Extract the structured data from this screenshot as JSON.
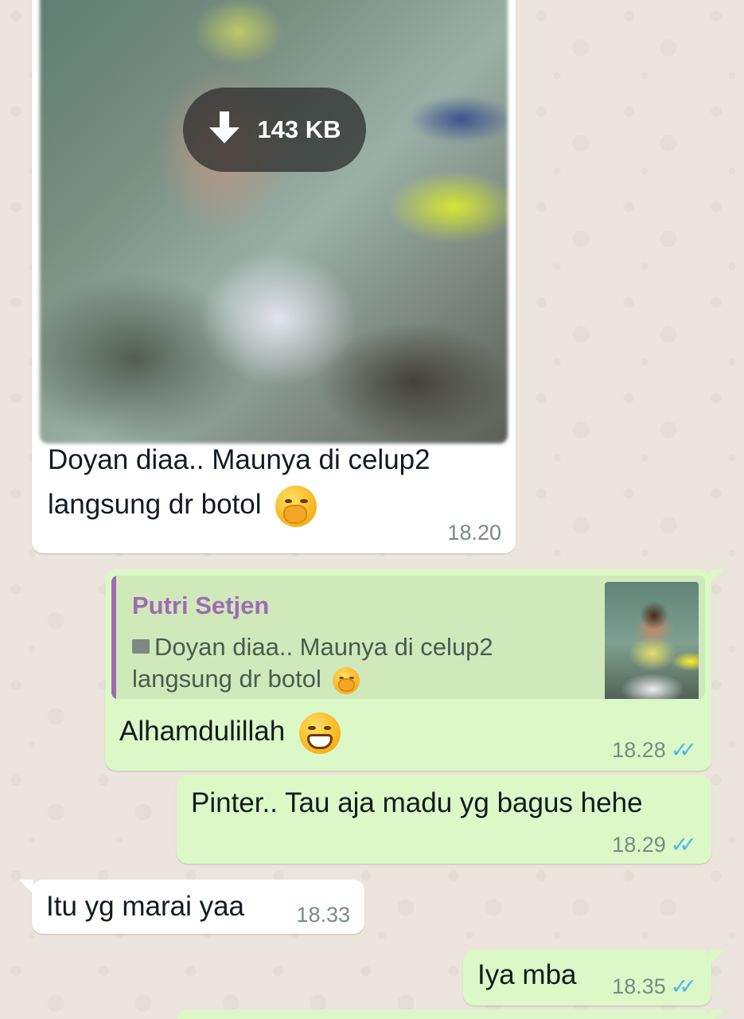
{
  "colors": {
    "wallpaper": "#ece5dd",
    "incoming_bubble": "#ffffff",
    "outgoing_bubble": "#dcf8c6",
    "quote_sender": "#9f6bb4",
    "read_ticks": "#4fb6ec"
  },
  "messages": [
    {
      "direction": "incoming",
      "type": "image",
      "download_size": "143 KB",
      "download_icon": "download-arrow-icon",
      "caption_line1": "Doyan diaa.. Maunya di celup2",
      "caption_line2": "langsung dr botol",
      "emoji": "face-with-hand-over-mouth",
      "time": "18.20"
    },
    {
      "direction": "outgoing",
      "type": "reply",
      "quoted": {
        "sender": "Putri Setjen",
        "icon": "image-icon",
        "text_line1": "Doyan diaa.. Maunya di celup2",
        "text_line2": "langsung dr botol",
        "emoji": "face-with-hand-over-mouth"
      },
      "text": "Alhamdulillah",
      "emoji": "grinning-face",
      "time": "18.28",
      "status": "read"
    },
    {
      "direction": "outgoing",
      "type": "text",
      "text": "Pinter.. Tau aja madu yg bagus hehe",
      "time": "18.29",
      "status": "read"
    },
    {
      "direction": "incoming",
      "type": "text",
      "text": "Itu yg marai yaa",
      "time": "18.33"
    },
    {
      "direction": "outgoing",
      "type": "text",
      "text": "Iya mba",
      "time": "18.35",
      "status": "read"
    }
  ],
  "ticks_glyph": "✓✓"
}
